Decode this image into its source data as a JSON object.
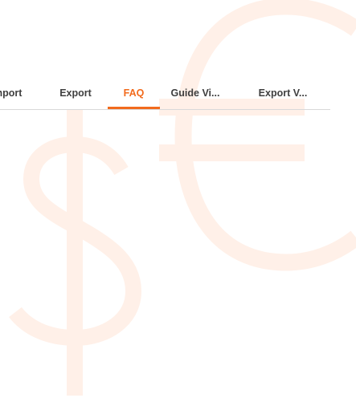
{
  "colors": {
    "accent": "#f26b1d",
    "background_symbol": "#fff0e8",
    "text": "#3f3f3f",
    "divider": "#d9d9d9"
  },
  "tabs": [
    {
      "label": "mport",
      "active": false
    },
    {
      "label": "Export",
      "active": false
    },
    {
      "label": "FAQ",
      "active": true
    },
    {
      "label": "Guide Vi...",
      "active": false
    },
    {
      "label": "Export V...",
      "active": false
    }
  ],
  "background": {
    "symbols": [
      "dollar-icon",
      "euro-icon"
    ]
  }
}
